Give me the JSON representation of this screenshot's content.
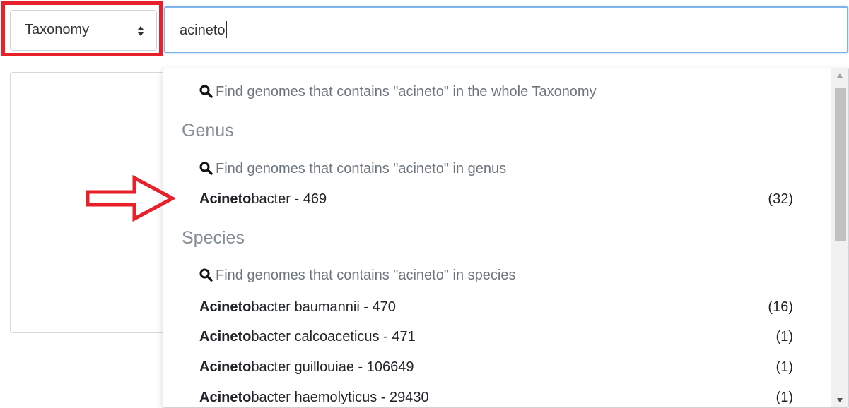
{
  "search_scope": {
    "selected": "Taxonomy"
  },
  "search": {
    "value": "acineto"
  },
  "dropdown": {
    "find_all": "Find genomes that contains \"acineto\" in the whole Taxonomy",
    "genus": {
      "header": "Genus",
      "find": "Find genomes that contains \"acineto\" in genus",
      "items": [
        {
          "match": "Acineto",
          "rest": "bacter - 469",
          "count": "(32)"
        }
      ]
    },
    "species": {
      "header": "Species",
      "find": "Find genomes that contains \"acineto\" in species",
      "items": [
        {
          "match": "Acineto",
          "rest": "bacter baumannii - 470",
          "count": "(16)"
        },
        {
          "match": "Acineto",
          "rest": "bacter calcoaceticus - 471",
          "count": "(1)"
        },
        {
          "match": "Acineto",
          "rest": "bacter guillouiae - 106649",
          "count": "(1)"
        },
        {
          "match": "Acineto",
          "rest": "bacter haemolyticus - 29430",
          "count": "(1)"
        }
      ]
    }
  },
  "colors": {
    "annotation_red": "#e8202a",
    "focus_blue": "#7fb4ea",
    "muted_gray": "#868e96"
  },
  "icons": [
    "select-arrows-icon",
    "search-icon",
    "scroll-up-icon",
    "scroll-down-icon",
    "red-arrow-annotation"
  ]
}
